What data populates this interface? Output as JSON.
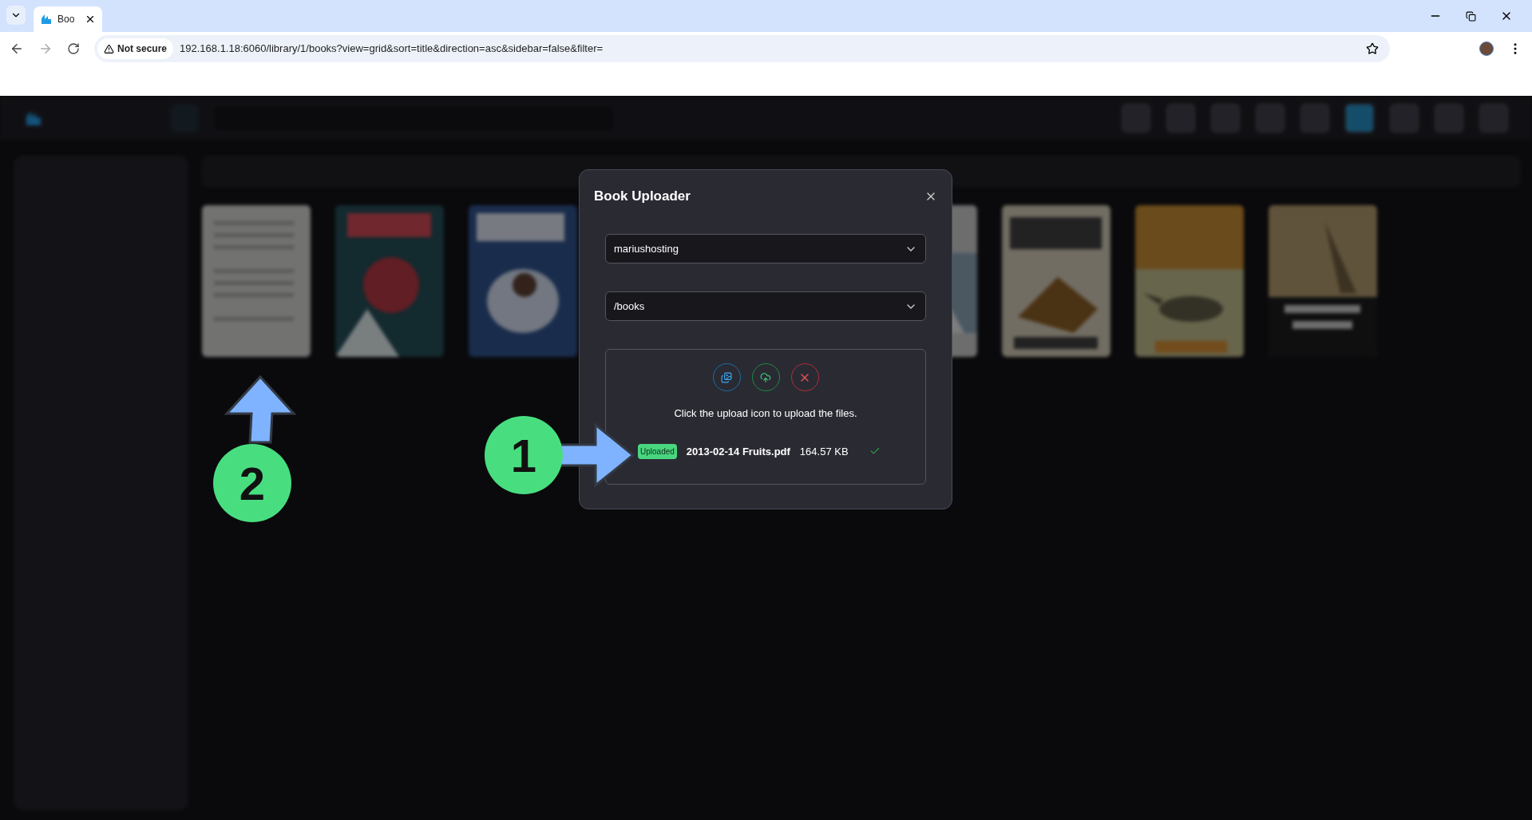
{
  "browser": {
    "tabs": [
      {
        "title": "Boo",
        "selected": true
      }
    ],
    "security": "Not secure",
    "url": "192.168.1.18:6060/library/1/books?view=grid&sort=title&direction=asc&sidebar=false&filter="
  },
  "modal": {
    "title": "Book Uploader",
    "library_select": "mariushosting",
    "path_select": "/books",
    "hint": "Click the upload icon to upload the files.",
    "files": [
      {
        "status": "Uploaded",
        "name": "2013-02-14 Fruits.pdf",
        "size": "164.57 KB",
        "done": true
      }
    ]
  },
  "callouts": [
    {
      "number": "1"
    },
    {
      "number": "2"
    }
  ]
}
